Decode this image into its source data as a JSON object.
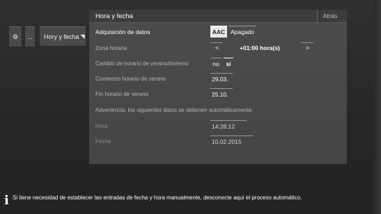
{
  "sidebar": {
    "gear_icon": "⚙",
    "more_label": "...",
    "breadcrumb_label": "Hory y fecha",
    "breadcrumb_arrow": "◥"
  },
  "panel": {
    "title": "Hora y fecha",
    "back_label": "Atrás"
  },
  "settings": {
    "data_acquisition": {
      "label": "Adquisición de datos",
      "options": [
        "AAC",
        "Apagado"
      ],
      "selected": "AAC"
    },
    "timezone": {
      "label": "Zona horaria",
      "prev": "<",
      "value": "+01:00 hora(s)",
      "next": ">"
    },
    "dst_change": {
      "label": "Cambio de horario de verano/invierno",
      "options": [
        "no",
        "sí"
      ],
      "selected": "sí"
    },
    "dst_start": {
      "label": "Comienzo horario de verano",
      "value": "29.03."
    },
    "dst_end": {
      "label": "Fin horario de verano",
      "value": "25.10."
    },
    "warning": "Advertencia: los siguientes datos se obtienen automáticamente.",
    "time": {
      "label": "Hora",
      "value": "14:26:12"
    },
    "date": {
      "label": "Fecha",
      "value": "10.02.2015"
    }
  },
  "info": {
    "icon": "i",
    "text": "Si tiene necesidad de establecer las entradas de fecha y hora manualmente, desconecte aquí el proceso automático."
  }
}
